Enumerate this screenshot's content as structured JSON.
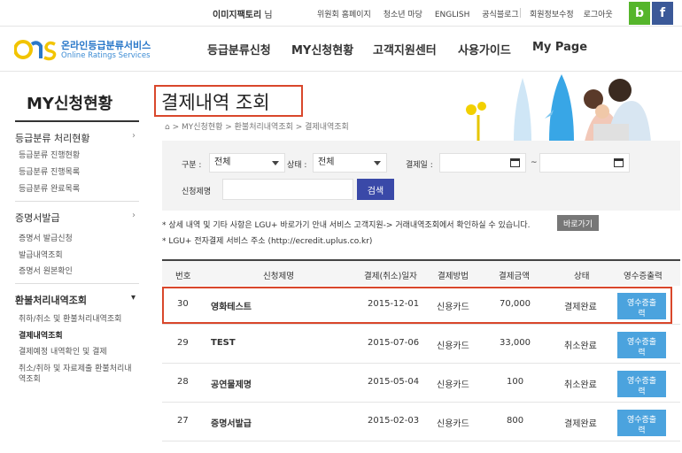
{
  "topbar": {
    "user_name": "이미지팩토리",
    "user_suffix": "님",
    "links": [
      "위원회 홈페이지",
      "청소년 마당",
      "ENGLISH",
      "공식블로그"
    ],
    "account_links": [
      "회원정보수정",
      "로그아웃"
    ],
    "sns_blog": "b",
    "sns_facebook": "f"
  },
  "logo": {
    "kor": "온라인등급분류서비스",
    "eng": "Online Ratings Services"
  },
  "nav": [
    "등급분류신청",
    "MY신청현황",
    "고객지원센터",
    "사용가이드",
    "My Page"
  ],
  "sidebar": {
    "title": "MY신청현황",
    "sections": [
      {
        "label": "등급분류 처리현황",
        "items": [
          "등급분류 진행현황",
          "등급분류 진행목록",
          "등급분류 완료목록"
        ]
      },
      {
        "label": "증명서발급",
        "items": [
          "증명서 발급신청",
          "발급내역조회",
          "증명서 원본확인"
        ]
      },
      {
        "label": "환불처리내역조회",
        "items": [
          "취하/취소 및 환불처리내역조회",
          "결제내역조회",
          "결제예정 내역확인 및 결제",
          "취소/취하 및 자료제출 환불처리내",
          "역조회"
        ]
      }
    ],
    "active_item": "결제내역조회"
  },
  "page": {
    "title": "결제내역 조회",
    "breadcrumb": "> MY신청현황 > 환불처리내역조회 > 결제내역조회"
  },
  "search": {
    "type_label": "구분 :",
    "type_value": "전체",
    "status_label": "상태 :",
    "status_value": "전체",
    "date_label": "결제일 :",
    "date_sep": "~",
    "name_label": "신청제명",
    "button": "검색"
  },
  "notes": {
    "line1": "* 상세 내역 및 기타 사항은 LGU+ 바로가기 안내 서비스 고객지원-> 거래내역조회에서 확인하실 수 있습니다.",
    "go_button": "바로가기",
    "line2": "* LGU+ 전자결제 서비스 주소 (http://ecredit.uplus.co.kr)"
  },
  "table": {
    "headers": [
      "번호",
      "신청제명",
      "결제(취소)일자",
      "결제방법",
      "결제금액",
      "상태",
      "영수증출력"
    ],
    "receipt_label_1": "영수증출",
    "receipt_label_2": "력",
    "rows": [
      {
        "no": "30",
        "name": "영화테스트",
        "date": "2015-12-01",
        "method": "신용카드",
        "amount": "70,000",
        "status": "결제완료"
      },
      {
        "no": "29",
        "name": "TEST",
        "date": "2015-07-06",
        "method": "신용카드",
        "amount": "33,000",
        "status": "취소완료"
      },
      {
        "no": "28",
        "name": "공연물제명",
        "date": "2015-05-04",
        "method": "신용카드",
        "amount": "100",
        "status": "취소완료"
      },
      {
        "no": "27",
        "name": "증명서발급",
        "date": "2015-02-03",
        "method": "신용카드",
        "amount": "800",
        "status": "결제완료"
      }
    ]
  },
  "colors": {
    "highlight": "#d9472b",
    "search_button": "#3a49a8",
    "receipt_button": "#4ba3de",
    "logo_blue": "#2a78c9"
  }
}
